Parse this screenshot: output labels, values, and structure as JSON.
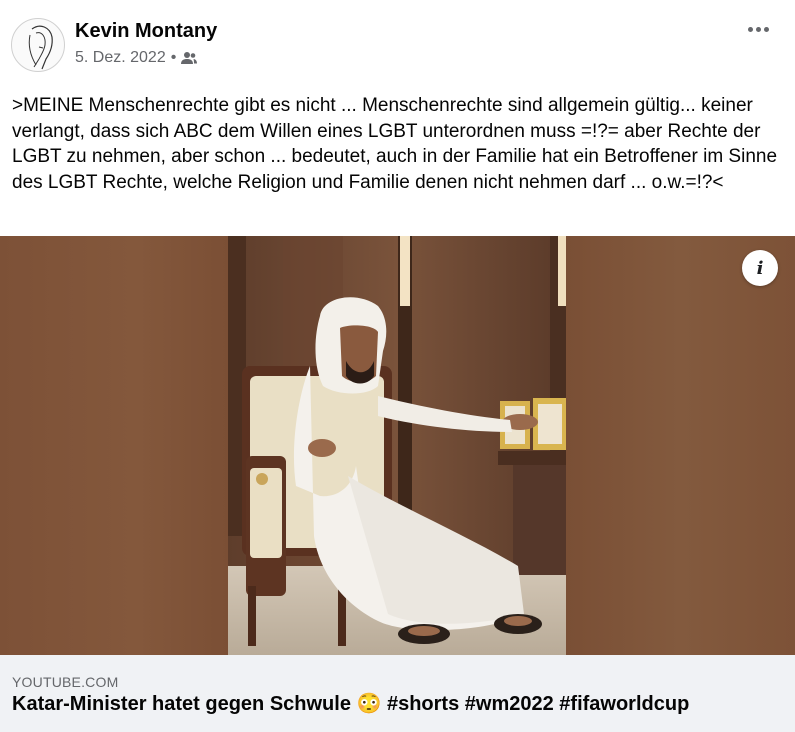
{
  "post": {
    "author": "Kevin Montany",
    "date": "5. Dez. 2022",
    "separator": "•",
    "audience_icon": "friends-icon",
    "text": ">MEINE Menschenrechte gibt es nicht ... Menschenrechte sind allgemein gültig... keiner verlangt, dass sich ABC dem Willen eines LGBT unterordnen muss =!?= aber Rechte der LGBT zu nehmen, aber schon ... bedeutet, auch in der Familie hat ein Betroffener im Sinne des LGBT Rechte, welche Religion und Familie denen nicht nehmen darf ... o.w.=!?<"
  },
  "media": {
    "info_label": "i"
  },
  "link": {
    "domain": "YOUTUBE.COM",
    "title": "Katar-Minister hatet gegen Schwule 😳 #shorts #wm2022 #fifaworldcup"
  }
}
